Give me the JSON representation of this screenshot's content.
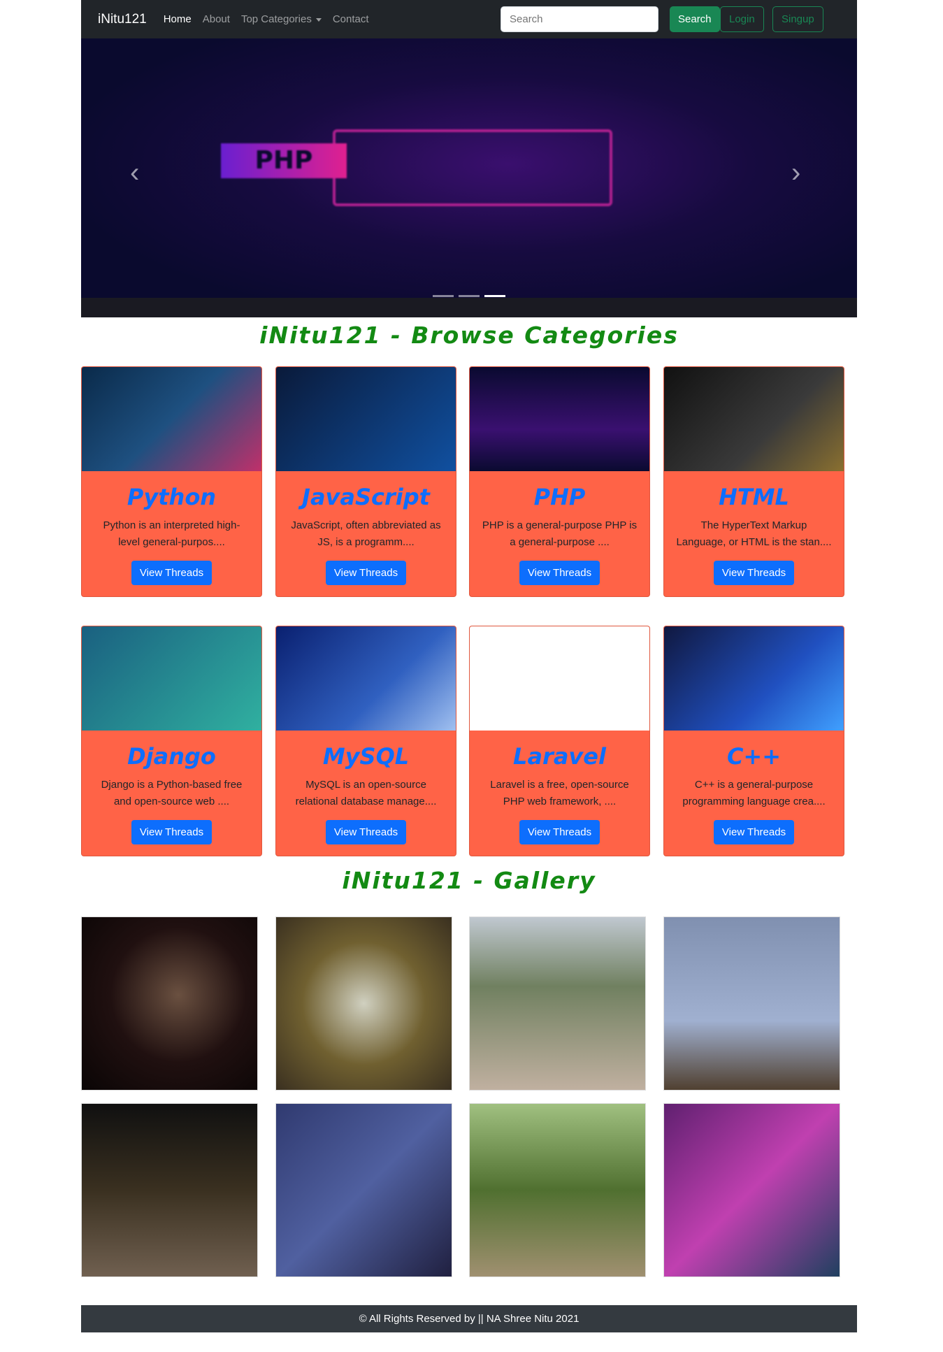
{
  "nav": {
    "brand": "iNitu121",
    "links": [
      "Home",
      "About",
      "Top Categories",
      "Contact"
    ],
    "search_placeholder": "Search",
    "search_btn": "Search",
    "login": "Login",
    "signup": "Singup"
  },
  "carousel": {
    "prev": "‹",
    "next": "›",
    "slide_count": 3,
    "active_slide": 3,
    "php_text": "PHP"
  },
  "categories_heading": "iNitu121  -  Browse Categories",
  "categories": [
    {
      "title": "Python",
      "desc": "Python is an interpreted high-level general-purpos....",
      "btn": "View Threads"
    },
    {
      "title": "JavaScript",
      "desc": "JavaScript, often abbreviated as JS, is a programm....",
      "btn": "View Threads"
    },
    {
      "title": "PHP",
      "desc": "PHP is a general-purpose PHP is a general-purpose ....",
      "btn": "View Threads"
    },
    {
      "title": "HTML",
      "desc": "The HyperText Markup Language, or HTML is the stan....",
      "btn": "View Threads"
    },
    {
      "title": "Django",
      "desc": "Django is a Python-based free and open-source web ....",
      "btn": "View Threads"
    },
    {
      "title": "MySQL",
      "desc": "MySQL is an open-source relational database manage....",
      "btn": "View Threads"
    },
    {
      "title": "Laravel",
      "desc": "Laravel is a free, open-source PHP web framework, ....",
      "btn": "View Threads"
    },
    {
      "title": "C++",
      "desc": "C++ is a general-purpose programming language crea....",
      "btn": "View Threads"
    }
  ],
  "gallery_heading": "iNitu121  -  Gallery",
  "footer": "© All Rights Reserved by || NA Shree Nitu 2021"
}
